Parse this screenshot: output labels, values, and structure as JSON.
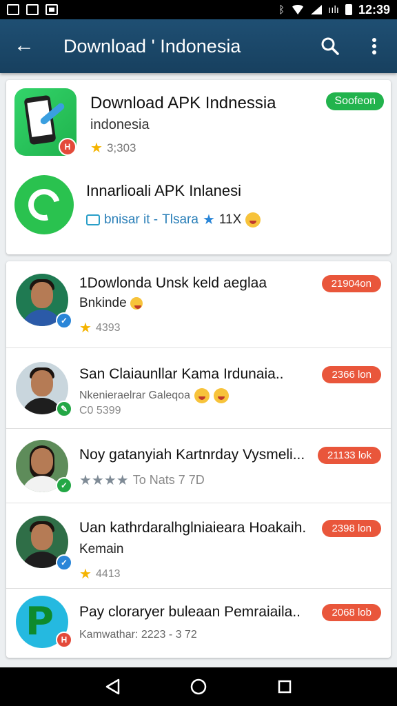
{
  "status_bar": {
    "time": "12:39",
    "signal_label": "ıılı"
  },
  "app_bar": {
    "back_icon": "←",
    "title": "Download ' Indonesia"
  },
  "featured": [
    {
      "title": "Download APK Indnessia",
      "subtitle": "indonesia",
      "rating": "3;303",
      "button": "Soofeon",
      "badge": "H"
    },
    {
      "title": "Innarlioali APK Inlanesi",
      "meta_left": "bnisar it -",
      "meta_mid": "Tlsara",
      "meta_count": "11X"
    }
  ],
  "list": [
    {
      "title": "1Dowlonda Unsk keld aeglaa",
      "subtitle": "Bnkinde",
      "meta": "4393",
      "price": "21904on"
    },
    {
      "title": "San Claiaunllar Kama Irdunaia..",
      "subtitle": "Nkenieraelrar Galeqoa",
      "meta": "C0 5399",
      "price": "2366 lon"
    },
    {
      "title": "Noy gatanyiah Kartnrday Vysmeli...",
      "subtitle": "",
      "meta": "To Nats  7    7D",
      "price": "21133 lok"
    },
    {
      "title": "Uan kathrdaralhglniaieara Hoakaih.",
      "subtitle": "Kemain",
      "meta": "4413",
      "price": "2398 lon"
    },
    {
      "title": "Pay cloraryer buleaan Pemraiaila..",
      "subtitle": "",
      "meta": "Kamwathar:  2223 - 3     72",
      "price": "2068 lob"
    }
  ],
  "colors": {
    "app_bar": "#1f4f73",
    "install": "#22b34d",
    "price": "#e9563b",
    "star": "#f5b400"
  },
  "icons": [
    "back-arrow-icon",
    "search-icon",
    "more-vert-icon",
    "back-nav-icon",
    "home-nav-icon",
    "recents-nav-icon"
  ]
}
